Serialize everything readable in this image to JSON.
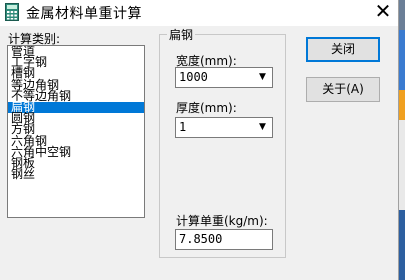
{
  "window": {
    "title": "金属材料单重计算",
    "close_glyph": "✕"
  },
  "category": {
    "label": "计算类别:",
    "items": [
      "管道",
      "工字钢",
      "槽钢",
      "等边角钢",
      "不等边角钢",
      "扁钢",
      "圆钢",
      "方钢",
      "六角钢",
      "六角中空钢",
      "钢板",
      "钢丝"
    ],
    "selected_index": 5
  },
  "group": {
    "title": "扁钢",
    "width_label": "宽度(mm):",
    "width_value": "1000",
    "thickness_label": "厚度(mm):",
    "thickness_value": "1",
    "unit_weight_label": "计算单重(kg/m):",
    "unit_weight_value": "7.8500"
  },
  "buttons": {
    "close": "关闭",
    "about": "关于(A)"
  },
  "colors": {
    "selection": "#0078d7",
    "button_face": "#e1e1e1",
    "window_bg": "#f0f0f0"
  }
}
